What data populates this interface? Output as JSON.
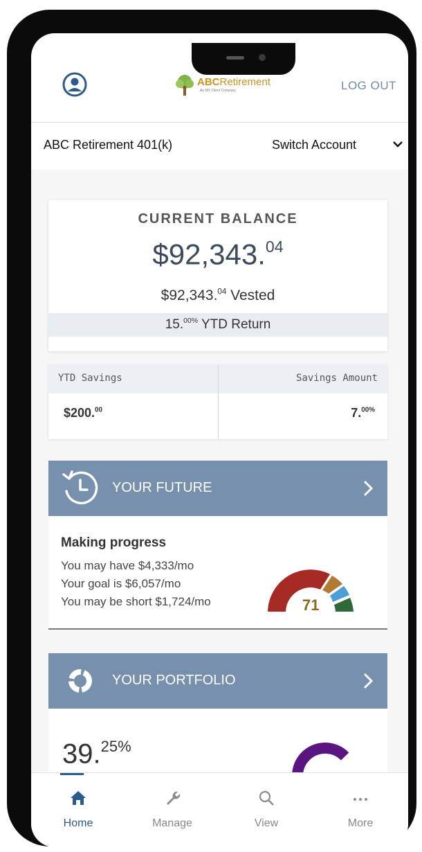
{
  "header": {
    "logo_brand_bold": "ABC",
    "logo_brand_rest": "Retirement",
    "logo_tagline": "An MY Client Company",
    "logout_label": "LOG OUT"
  },
  "account": {
    "name": "ABC Retirement 401(k)",
    "switch_label": "Switch Account"
  },
  "balance": {
    "label": "CURRENT BALANCE",
    "amount_main": "$92,343.",
    "amount_cents": "04",
    "vested_main": "$92,343.",
    "vested_cents": "04",
    "vested_suffix": " Vested",
    "ytd_main": "15.",
    "ytd_decimals": "00%",
    "ytd_suffix": " YTD Return"
  },
  "savings": {
    "ytd_label": "YTD Savings",
    "ytd_main": "$200.",
    "ytd_cents": "00",
    "amount_label": "Savings Amount",
    "amount_main": "7.",
    "amount_decimals": "00%"
  },
  "future": {
    "title": "YOUR FUTURE",
    "status": "Making progress",
    "line1": "You may have $4,333/mo",
    "line2": "Your goal is $6,057/mo",
    "line3": "You may be short $1,724/mo",
    "score": "71",
    "score_color": "#8a6a1e",
    "colors": {
      "red": "#a62a24",
      "brown": "#b37a33",
      "blue": "#4a9fd6",
      "green": "#2e6a38"
    }
  },
  "portfolio": {
    "title": "YOUR PORTFOLIO",
    "pct_main": "39.",
    "pct_decimals": "25%",
    "colors": {
      "purple": "#5a1580",
      "teal": "#2ec4b6",
      "pink": "#d61f6e"
    }
  },
  "tabs": [
    {
      "label": "Home",
      "icon": "home-icon",
      "active": true
    },
    {
      "label": "Manage",
      "icon": "wrench-icon",
      "active": false
    },
    {
      "label": "View",
      "icon": "search-icon",
      "active": false
    },
    {
      "label": "More",
      "icon": "more-icon",
      "active": false
    }
  ],
  "accent_color": "#7690ad"
}
